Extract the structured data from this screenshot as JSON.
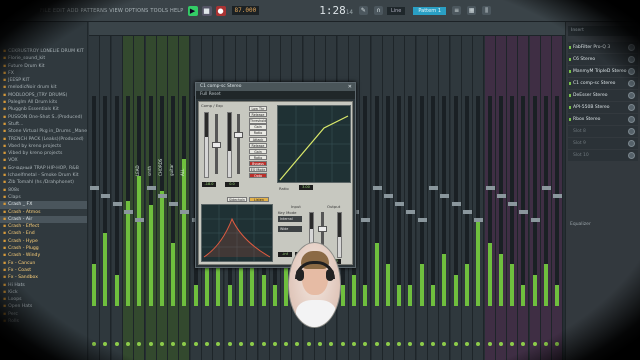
{
  "toolbar": {
    "menu_text": "FILE EDIT ADD PATTERNS VIEW OPTIONS TOOLS HELP",
    "tempo": "87.000",
    "time": "1:28",
    "time_sub": "14",
    "pattern": "Pattern 1",
    "line_label": "Line"
  },
  "browser": {
    "items": [
      {
        "label": "CEKRUSTROY LONELIE DRUM KIT",
        "state": ""
      },
      {
        "label": "Florie_sound_kit",
        "state": ""
      },
      {
        "label": "Future Drum Kit",
        "state": ""
      },
      {
        "label": "FX",
        "state": ""
      },
      {
        "label": "JEESP KIT",
        "state": ""
      },
      {
        "label": "melodicNoir drum kit",
        "state": ""
      },
      {
        "label": "MODLOOPS_(TRY DRUMS)",
        "state": ""
      },
      {
        "label": "Paleglm All Drum kits",
        "state": ""
      },
      {
        "label": "Pluggnb Essentials Kit",
        "state": ""
      },
      {
        "label": "PUSSON One-Shot S..(Produced)",
        "state": ""
      },
      {
        "label": "Stuft...",
        "state": ""
      },
      {
        "label": "Stone Virtual Pkg in_Drums _Mane)",
        "state": ""
      },
      {
        "label": "TRENCH PACK (Leaks)(Produced)",
        "state": ""
      },
      {
        "label": "Vbed by kreno projects",
        "state": ""
      },
      {
        "label": "Vibed by kreno projects",
        "state": ""
      },
      {
        "label": "VOX",
        "state": ""
      },
      {
        "label": "Бочадный TRAP HIP-HOP, R&B",
        "state": ""
      },
      {
        "label": "Ichaelfmetal - Smoke Drum Kit",
        "state": ""
      },
      {
        "label": "Zlb Tomahl (hs /Drahphonet)",
        "state": ""
      },
      {
        "label": "808s",
        "state": ""
      },
      {
        "label": "Claps",
        "state": ""
      },
      {
        "label": "Crash _ FX",
        "state": "sel"
      },
      {
        "label": "Crash - Atmos",
        "state": "hl"
      },
      {
        "label": "Crash - Air",
        "state": "sel"
      },
      {
        "label": "Crash - Effect",
        "state": "hl"
      },
      {
        "label": "Crash - End",
        "state": "hl"
      },
      {
        "label": "Crash - Hype",
        "state": "hl"
      },
      {
        "label": "Crash - Plugg",
        "state": "hl"
      },
      {
        "label": "Crash - Windy",
        "state": "hl"
      },
      {
        "label": "Fx - Cancun",
        "state": "hl"
      },
      {
        "label": "Fx - Coast",
        "state": "hl"
      },
      {
        "label": "Fx - Sandbox",
        "state": "hl"
      },
      {
        "label": "Hi Hats",
        "state": ""
      },
      {
        "label": "Kick",
        "state": ""
      },
      {
        "label": "Loops",
        "state": ""
      },
      {
        "label": "Open Hats",
        "state": ""
      },
      {
        "label": "Perc",
        "state": ""
      },
      {
        "label": "Rolls",
        "state": ""
      }
    ]
  },
  "mixer": {
    "track_labels": [
      "",
      "",
      "",
      "",
      "LEAD",
      "smth",
      "CHORDS",
      "guitar",
      "ALL",
      "",
      "",
      "",
      "",
      "",
      "",
      "",
      "",
      "",
      "",
      "",
      "",
      "",
      "",
      "",
      "",
      "",
      "",
      "",
      "",
      "",
      "",
      "",
      "",
      "",
      "",
      "",
      "",
      "",
      "",
      "",
      "",
      ""
    ]
  },
  "fx": {
    "header": "Insert",
    "slots": [
      {
        "name": "FabFilter Pro-Q 3",
        "empty": false
      },
      {
        "name": "C6 Stereo",
        "empty": false
      },
      {
        "name": "ManmyM TripleD Stereo",
        "empty": false
      },
      {
        "name": "C1 comp-sc Stereo",
        "empty": false
      },
      {
        "name": "DeEsser Stereo",
        "empty": false
      },
      {
        "name": "API-550B Stereo",
        "empty": false
      },
      {
        "name": "Rbox Stereo",
        "empty": false
      },
      {
        "name": "Slot 8",
        "empty": true
      },
      {
        "name": "Slot 9",
        "empty": true
      },
      {
        "name": "Slot 10",
        "empty": true
      }
    ],
    "equalizer_label": "Equalizer"
  },
  "plugin": {
    "title": "C1 comp-sc Stereo",
    "preset_bar": "Full Reset",
    "comp_label": "Comp / Exp",
    "thresh_label": "Threshold",
    "makeup_label": "Makeup",
    "ratio_label": "Ratio",
    "input_label": "Input",
    "output_label": "Output",
    "key_mode_label": "Key Mode",
    "buttons": [
      {
        "label": "Low Thr",
        "style": ""
      },
      {
        "label": "Release",
        "style": ""
      },
      {
        "label": "Threshold",
        "style": ""
      },
      {
        "label": "Gain",
        "style": ""
      },
      {
        "label": "Ratio",
        "style": ""
      },
      {
        "label": "Attack",
        "style": ""
      },
      {
        "label": "Release",
        "style": ""
      },
      {
        "label": "Gain",
        "style": ""
      },
      {
        "label": "Ratio",
        "style": ""
      },
      {
        "label": "Bypass",
        "style": "active"
      },
      {
        "label": "EQ Mode",
        "style": ""
      },
      {
        "label": "Opto",
        "style": "active"
      }
    ],
    "eq_tabs": [
      {
        "label": "Sidechain",
        "style": ""
      },
      {
        "label": "Listen",
        "style": "amber"
      }
    ],
    "key_dropdown": "Internal",
    "sc_dropdown": "Wide",
    "readouts": [
      "-18.0",
      "0.0",
      "3.00",
      "-inf",
      "0.0",
      "12.0"
    ]
  }
}
